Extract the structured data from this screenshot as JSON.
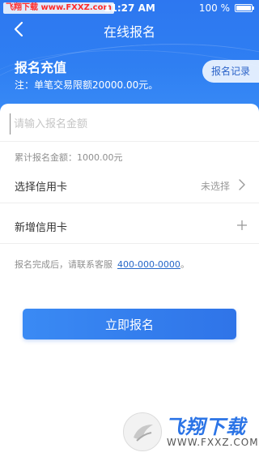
{
  "status_bar": {
    "watermark": "飞翔下载 www.FXXZ.com",
    "time": "11:27 AM",
    "battery_text": "100 %",
    "battery_level": 1.0
  },
  "nav": {
    "title": "在线报名",
    "back_icon": "chevron-left-icon"
  },
  "hero": {
    "title": "报名充值",
    "note": "注：单笔交易限额20000.00元。",
    "record_button": "报名记录"
  },
  "form": {
    "amount_placeholder": "请输入报名金额",
    "amount_value": "",
    "total_text": "累计报名金额：1000.00元",
    "select_card": {
      "label": "选择信用卡",
      "value": "未选择",
      "icon": "chevron-right-icon"
    },
    "add_card": {
      "label": "新增信用卡",
      "icon": "plus-icon"
    },
    "hint_text": "报名完成后，请联系客服",
    "hint_phone": "400-000-0000",
    "hint_suffix": "。",
    "submit_label": "立即报名"
  },
  "watermark_logo": {
    "name": "飞翔下载",
    "url": "WWW.FXXZ.COM"
  },
  "colors": {
    "primary": "#2f7ff2",
    "link": "#2466c8",
    "text": "#333333",
    "muted": "#8f8f8f"
  }
}
